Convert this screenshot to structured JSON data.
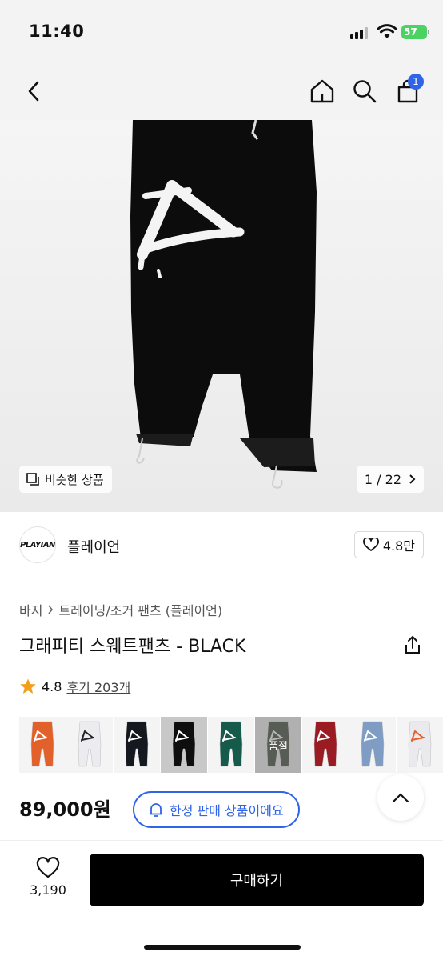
{
  "status": {
    "time": "11:40",
    "battery": "57"
  },
  "nav": {
    "cart_count": "1"
  },
  "gallery": {
    "similar_label": "비슷한 상품",
    "page": "1 / 22"
  },
  "brand": {
    "name": "플레이언",
    "logo_text": "PLAYIAN",
    "likes": "4.8만"
  },
  "breadcrumb": {
    "category": "바지",
    "sub": "트레이닝/조거 팬츠 (플레이언)"
  },
  "product": {
    "title": "그래피티 스웨트팬츠 - BLACK",
    "rating": "4.8",
    "reviews": "후기 203개",
    "price": "89,000원",
    "limited_label": "한정 판매 상품이에요"
  },
  "colors": [
    {
      "color": "#e2602a",
      "accent": "#ffffff"
    },
    {
      "color": "#ececf0",
      "accent": "#222222"
    },
    {
      "color": "#161820",
      "accent": "#ffffff"
    },
    {
      "color": "#0e0e0e",
      "accent": "#ffffff",
      "selected": true
    },
    {
      "color": "#165a4c",
      "accent": "#ffffff"
    },
    {
      "color": "#2f3a2c",
      "accent": "#ffffff",
      "soldout": "품절"
    },
    {
      "color": "#9a1c22",
      "accent": "#ffffff"
    },
    {
      "color": "#7e9cc4",
      "accent": "#ffffff"
    },
    {
      "color": "#e9e9ee",
      "accent": "#e2602a"
    }
  ],
  "bottom": {
    "wish_count": "3,190",
    "buy_label": "구매하기"
  },
  "theme": {
    "accent": "#2f63e8",
    "star": "#f2a019"
  }
}
